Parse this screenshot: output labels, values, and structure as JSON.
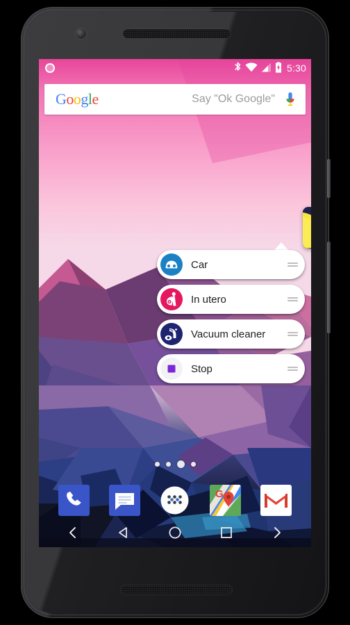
{
  "device": {
    "name": "android-phone",
    "front_camera": "camera-icon",
    "earpiece": "earpiece-speaker",
    "bottom_speaker": "bottom-speaker",
    "power_button": "power-button",
    "volume_button": "volume-rocker"
  },
  "status_bar": {
    "ongoing_indicator_icon": "ongoing-recording-icon",
    "bluetooth_icon": "bluetooth-icon",
    "wifi_icon": "wifi-icon",
    "signal_icon": "cell-signal-icon",
    "battery_icon": "battery-charging-icon",
    "time": "5:30",
    "background_color": "#d6338a",
    "text_color": "#ffffff"
  },
  "search_bar": {
    "logo": "Google",
    "logo_letters": [
      "G",
      "o",
      "o",
      "g",
      "l",
      "e"
    ],
    "placeholder": "Say \"Ok Google\"",
    "mic_icon": "microphone-icon"
  },
  "app_icon": {
    "name": "baby-monitor-app-icon",
    "description": "sleeping baby on moon"
  },
  "popup_menu": {
    "items": [
      {
        "label": "Car",
        "icon": "car-icon",
        "icon_color": "#1c81c4",
        "handle": "drag-handle-icon"
      },
      {
        "label": "In utero",
        "icon": "pregnant-woman-icon",
        "icon_color": "#e5175f",
        "handle": "drag-handle-icon"
      },
      {
        "label": "Vacuum cleaner",
        "icon": "vacuum-cleaner-icon",
        "icon_color": "#1e2470",
        "handle": "drag-handle-icon"
      },
      {
        "label": "Stop",
        "icon": "stop-square-icon",
        "icon_color": "#7b27d8",
        "handle": "drag-handle-icon"
      }
    ]
  },
  "page_indicator": {
    "total": 4,
    "active_index": 2
  },
  "dock": {
    "items": [
      {
        "name": "phone-app",
        "label": "Phone"
      },
      {
        "name": "messages-app",
        "label": "Messages"
      },
      {
        "name": "app-drawer",
        "label": "All apps"
      },
      {
        "name": "maps-app",
        "label": "Maps"
      },
      {
        "name": "gmail-app",
        "label": "Gmail"
      }
    ]
  },
  "nav_bar": {
    "items": [
      {
        "name": "prev-chevron",
        "label": "Previous"
      },
      {
        "name": "back-button",
        "label": "Back"
      },
      {
        "name": "home-button",
        "label": "Home"
      },
      {
        "name": "recents-button",
        "label": "Recents"
      },
      {
        "name": "next-chevron",
        "label": "Next"
      }
    ]
  },
  "colors": {
    "status_pink": "#d6338a",
    "wallpaper_top": "#f06bae",
    "wallpaper_bottom": "#0b0d1e",
    "accent_purple": "#7b27d8"
  }
}
